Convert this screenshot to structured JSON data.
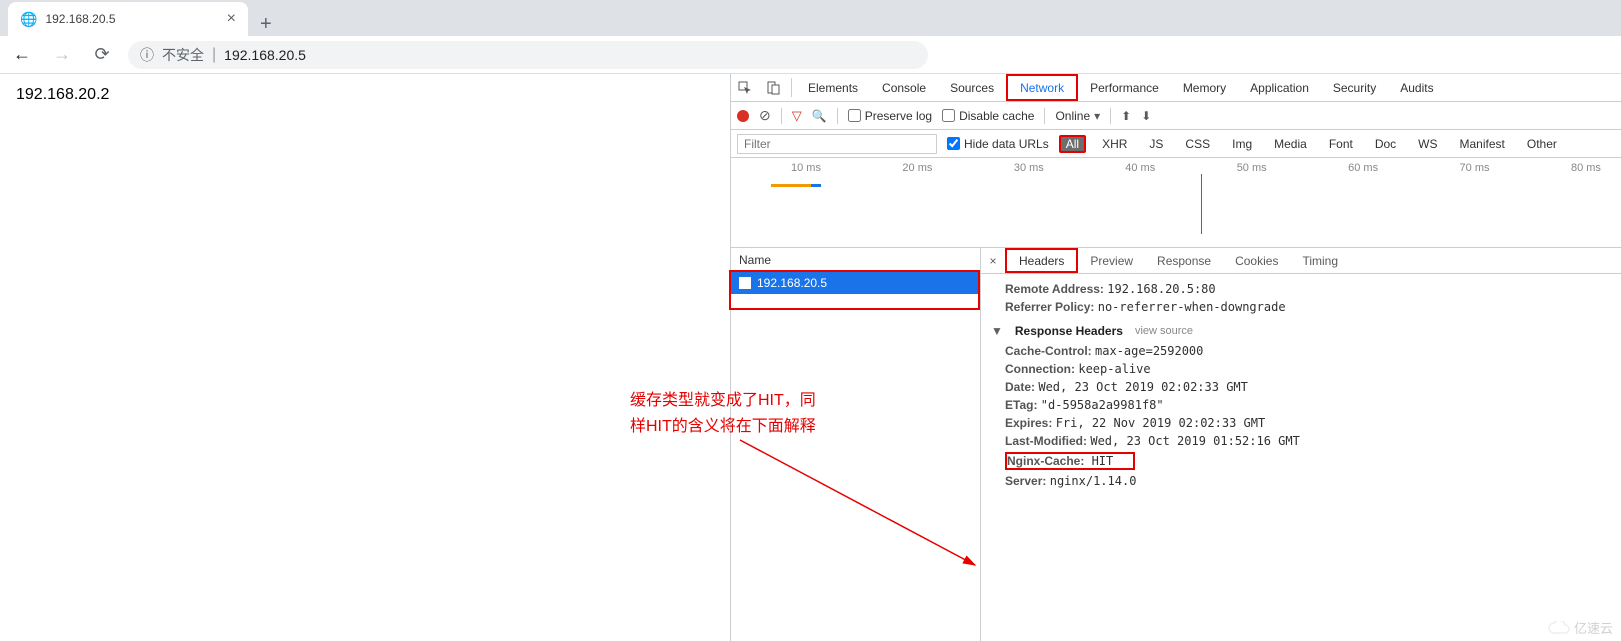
{
  "browser": {
    "tab_title": "192.168.20.5",
    "insecure_label": "不安全",
    "url": "192.168.20.5"
  },
  "page": {
    "body_text": "192.168.20.2"
  },
  "devtools": {
    "tabs": [
      "Elements",
      "Console",
      "Sources",
      "Network",
      "Performance",
      "Memory",
      "Application",
      "Security",
      "Audits"
    ],
    "active_tab": "Network",
    "preserve_log_label": "Preserve log",
    "disable_cache_label": "Disable cache",
    "online_label": "Online",
    "filter_placeholder": "Filter",
    "hide_data_urls_label": "Hide data URLs",
    "type_filters": [
      "All",
      "XHR",
      "JS",
      "CSS",
      "Img",
      "Media",
      "Font",
      "Doc",
      "WS",
      "Manifest",
      "Other"
    ],
    "active_type_filter": "All",
    "timeline_ticks": [
      "10 ms",
      "20 ms",
      "30 ms",
      "40 ms",
      "50 ms",
      "60 ms",
      "70 ms",
      "80 ms"
    ],
    "request_list": {
      "header": "Name",
      "rows": [
        "192.168.20.5"
      ]
    },
    "detail_tabs": [
      "Headers",
      "Preview",
      "Response",
      "Cookies",
      "Timing"
    ],
    "active_detail_tab": "Headers",
    "general": {
      "remote_address_label": "Remote Address:",
      "remote_address": "192.168.20.5:80",
      "referrer_policy_label": "Referrer Policy:",
      "referrer_policy": "no-referrer-when-downgrade"
    },
    "response_headers_label": "Response Headers",
    "view_source_label": "view source",
    "response_headers": {
      "cache_control_k": "Cache-Control:",
      "cache_control_v": "max-age=2592000",
      "connection_k": "Connection:",
      "connection_v": "keep-alive",
      "date_k": "Date:",
      "date_v": "Wed, 23 Oct 2019 02:02:33 GMT",
      "etag_k": "ETag:",
      "etag_v": "\"d-5958a2a9981f8\"",
      "expires_k": "Expires:",
      "expires_v": "Fri, 22 Nov 2019 02:02:33 GMT",
      "last_modified_k": "Last-Modified:",
      "last_modified_v": "Wed, 23 Oct 2019 01:52:16 GMT",
      "nginx_cache_k": "Nginx-Cache:",
      "nginx_cache_v": "HIT",
      "server_k": "Server:",
      "server_v": "nginx/1.14.0"
    }
  },
  "annotation": {
    "line1": "缓存类型就变成了HIT，同",
    "line2": "样HIT的含义将在下面解释"
  },
  "watermark": "亿速云"
}
